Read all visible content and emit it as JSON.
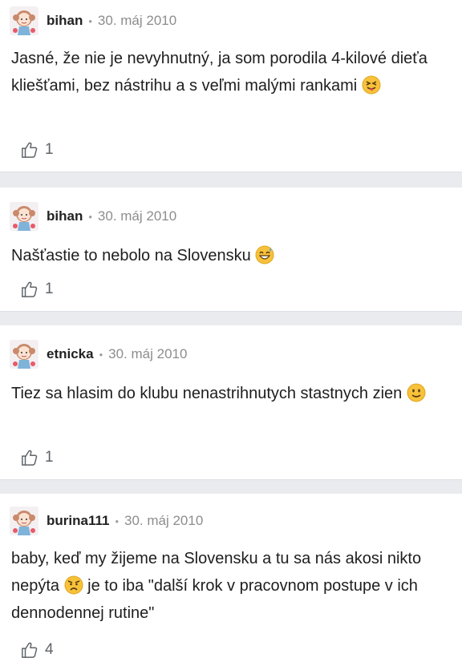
{
  "comments": [
    {
      "author": "bihan",
      "separator": "•",
      "date": "30. máj 2010",
      "text_parts": [
        "Jasné, že nie je nevyhnutný, ja som porodila 4-kilové dieťa kliešťami, bez nástrihu a s veľmi malými rankami "
      ],
      "emojis": [
        "tongue-wink-emoji"
      ],
      "likes": "1",
      "like_icon": "thumbs-up-icon",
      "avatar_icon": "girl-avatar-icon"
    },
    {
      "author": "bihan",
      "separator": "•",
      "date": "30. máj 2010",
      "text_parts": [
        "Našťastie to nebolo na Slovensku "
      ],
      "emojis": [
        "sweat-smile-emoji"
      ],
      "likes": "1",
      "like_icon": "thumbs-up-icon",
      "avatar_icon": "girl-avatar-icon"
    },
    {
      "author": "etnicka",
      "separator": "•",
      "date": "30. máj 2010",
      "text_parts": [
        "Tiez sa hlasim do klubu nenastrihnutych stastnych zien "
      ],
      "emojis": [
        "slight-smile-emoji"
      ],
      "likes": "1",
      "like_icon": "thumbs-up-icon",
      "avatar_icon": "girl-avatar-icon"
    },
    {
      "author": "burina111",
      "separator": "•",
      "date": "30. máj 2010",
      "text_parts": [
        "baby, keď my žijeme na Slovensku a tu sa nás akosi nikto nepýta ",
        " je to iba \"další krok v pracovnom postupe v ich dennodennej rutine\""
      ],
      "emojis": [
        "angry-face-emoji"
      ],
      "likes": "4",
      "like_icon": "thumbs-up-icon",
      "avatar_icon": "girl-avatar-icon"
    }
  ],
  "colors": {
    "background": "#e9ebee",
    "card": "#ffffff",
    "meta_text": "#8d8d8d",
    "emoji_yellow": "#f7c23a"
  }
}
